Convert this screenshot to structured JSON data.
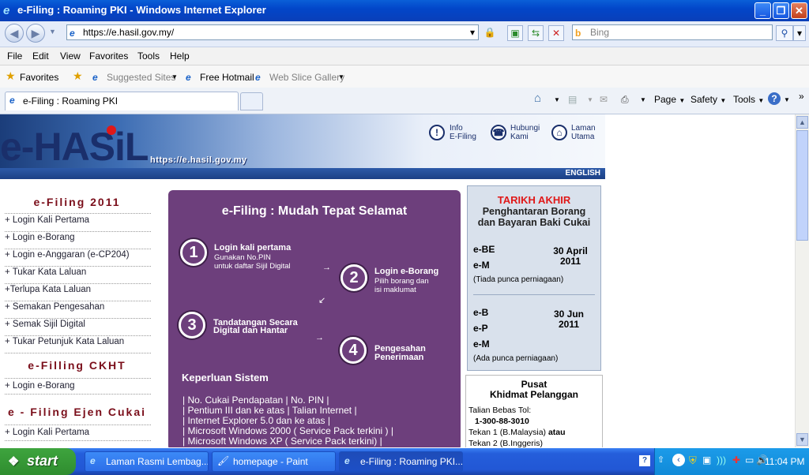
{
  "window": {
    "title": "e-Filing : Roaming PKI - Windows Internet Explorer"
  },
  "address": {
    "url": "https://e.hasil.gov.my/",
    "search_placeholder": "Bing"
  },
  "menu": [
    "File",
    "Edit",
    "View",
    "Favorites",
    "Tools",
    "Help"
  ],
  "favorites": {
    "label": "Favorites",
    "items": [
      "Suggested Sites",
      "Free Hotmail",
      "Web Slice Gallery"
    ]
  },
  "tab": {
    "title": "e-Filing : Roaming PKI"
  },
  "commands": {
    "page": "Page",
    "safety": "Safety",
    "tools": "Tools"
  },
  "banner": {
    "logo": "e-HASiL",
    "url": "https://e.hasil.gov.my",
    "links": [
      {
        "line1": "Info",
        "line2": "E-Filing",
        "icon": "info-icon"
      },
      {
        "line1": "Hubungi",
        "line2": "Kami",
        "icon": "phone-icon"
      },
      {
        "line1": "Laman",
        "line2": "Utama",
        "icon": "home-icon"
      }
    ],
    "english": "ENGLISH"
  },
  "nav": {
    "section1": "e-Filing 2011",
    "items1": [
      "+ Login Kali Pertama",
      "+ Login e-Borang",
      "+ Login e-Anggaran (e-CP204)",
      "+ Tukar Kata Laluan",
      "+Terlupa Kata Laluan",
      "+ Semakan Pengesahan",
      "+ Semak Sijil Digital",
      "+ Tukar Petunjuk Kata Laluan"
    ],
    "section2": "e-Filling CKHT",
    "items2": [
      "+ Login e-Borang"
    ],
    "section3": "e - Filing Ejen Cukai",
    "items3": [
      "+ Login Kali Pertama"
    ]
  },
  "panel": {
    "title": "e-Filing : Mudah Tepat  Selamat",
    "steps": [
      {
        "num": "1",
        "title": "Login kali pertama",
        "sub1": "Gunakan No.PIN",
        "sub2": "untuk daftar Sijil Digital"
      },
      {
        "num": "2",
        "title": "Login e-Borang",
        "sub1": "Pilih borang dan",
        "sub2": "isi maklumat"
      },
      {
        "num": "3",
        "title": "Tandatangan Secara",
        "sub1": "Digital dan Hantar",
        "sub2": ""
      },
      {
        "num": "4",
        "title": "Pengesahan",
        "sub1": "Penerimaan",
        "sub2": ""
      }
    ],
    "req_title": "Keperluan Sistem",
    "reqs": [
      "| No. Cukai Pendapatan | No. PIN |",
      "| Pentium III dan ke atas | Talian Internet |",
      "| Internet Explorer 5.0 dan ke atas |",
      "| Microsoft Windows 2000 ( Service Pack terkini ) |",
      "| Microsoft Windows XP ( Service Pack terkini) |"
    ]
  },
  "deadline": {
    "heading": "TARIKH AKHIR",
    "sub": "Penghantaran Borang dan Bayaran Baki Cukai",
    "group1": {
      "forms": [
        "e-BE",
        "e-M"
      ],
      "date": "30 April 2011",
      "note": "(Tiada punca perniagaan)"
    },
    "group2": {
      "forms": [
        "e-B",
        "e-P",
        "e-M"
      ],
      "date": "30 Jun 2011",
      "note": "(Ada punca perniagaan)"
    }
  },
  "pusat": {
    "title1": "Pusat",
    "title2": "Khidmat Pelanggan",
    "tol_label": "Talian Bebas Tol:",
    "tol_number": "1-300-88-3010",
    "line1_pre": "Tekan 1 (B.Malaysia)",
    "line1_post": "atau",
    "line2": "Tekan 2 (B.Inggeris)"
  },
  "taskbar": {
    "start": "start",
    "tasks": [
      "Laman Rasmi Lembag...",
      "homepage - Paint",
      "e-Filing : Roaming PKI..."
    ],
    "clock": "11:04 PM"
  }
}
